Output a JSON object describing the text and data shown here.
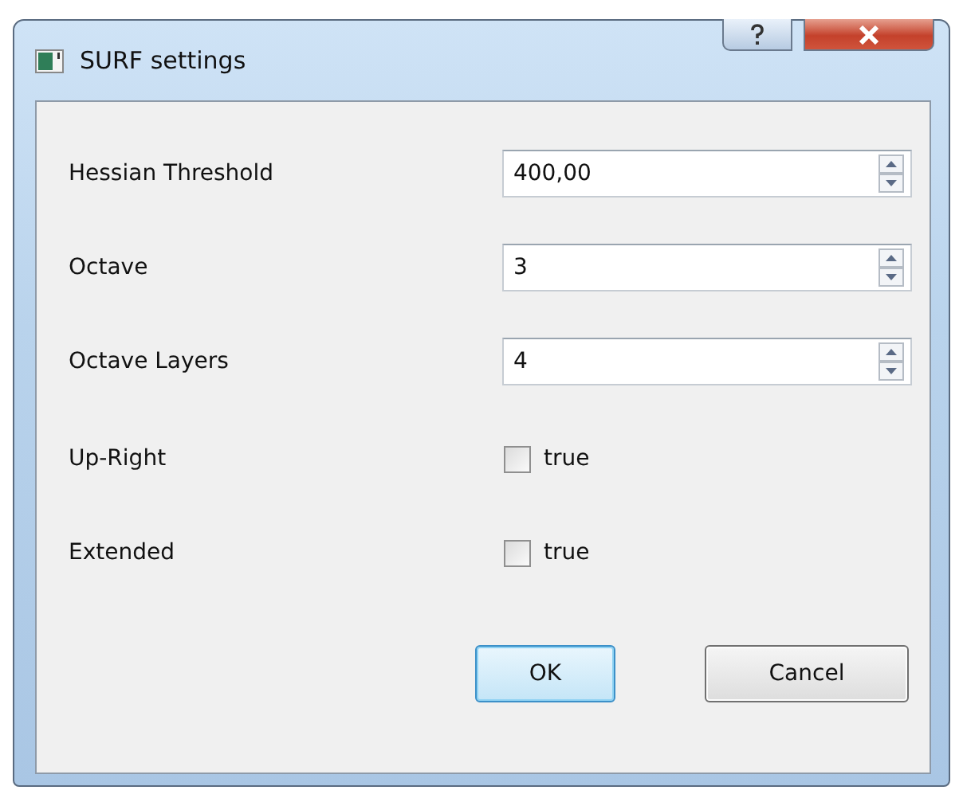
{
  "window": {
    "title": "SURF settings"
  },
  "fields": [
    {
      "kind": "spin",
      "label": "Hessian Threshold",
      "value": "400,00"
    },
    {
      "kind": "spin",
      "label": "Octave",
      "value": "3"
    },
    {
      "kind": "spin",
      "label": "Octave Layers",
      "value": "4"
    },
    {
      "kind": "checkbox",
      "label": "Up-Right",
      "text": "true",
      "checked": false
    },
    {
      "kind": "checkbox",
      "label": "Extended",
      "text": "true",
      "checked": false
    }
  ],
  "buttons": [
    {
      "label": "OK",
      "default": true
    },
    {
      "label": "Cancel",
      "default": false
    }
  ]
}
